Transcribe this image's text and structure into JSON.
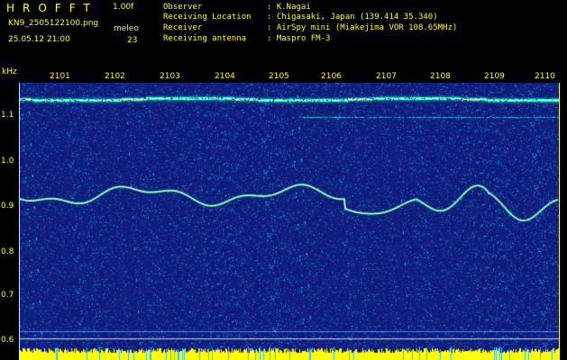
{
  "header": {
    "app_title": "HROFFT",
    "version": "1.00f",
    "filename": "KN9_2505122100.png",
    "timestamp": "25.05.12 21:00",
    "mode": "meleo",
    "count": "23",
    "meta": [
      {
        "key": "Observer",
        "value": ": K.Nagai"
      },
      {
        "key": "Receiving Location",
        "value": ": Chigasaki, Japan (139.414 35.340)"
      },
      {
        "key": "Receiver",
        "value": ": AirSpy mini (Miakejima VOR 108.65MHz)"
      },
      {
        "key": "Receiving antenna",
        "value": ": Maspro FM-3"
      }
    ]
  },
  "axes": {
    "y_unit": "kHz",
    "x_ticks": [
      "2101",
      "2102",
      "2103",
      "2104",
      "2105",
      "2106",
      "2107",
      "2108",
      "2109",
      "2110"
    ],
    "y_ticks": [
      "1.1",
      "1.0",
      "0.9",
      "0.8",
      "0.7",
      "0.6"
    ]
  },
  "colors": {
    "text": "#ffff00",
    "background": "#101a78",
    "signal": "#00ffee",
    "trace": "#e8ffb0"
  }
}
